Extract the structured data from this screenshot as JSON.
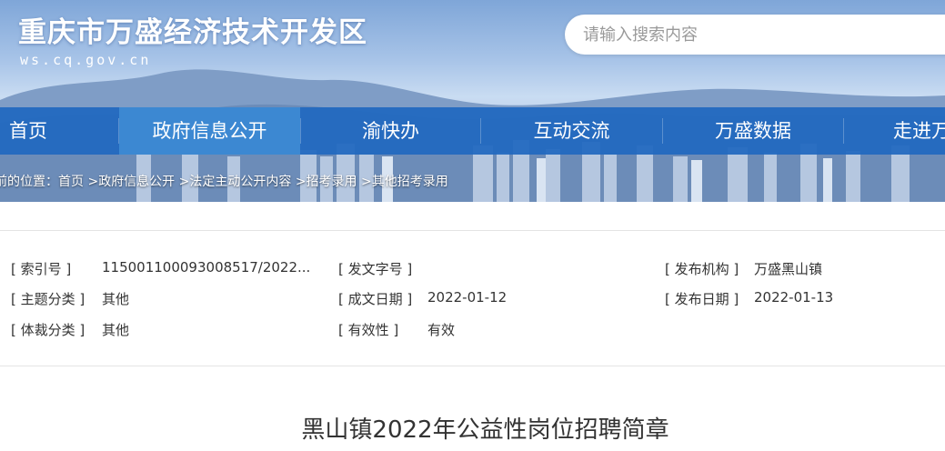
{
  "header": {
    "site_title": "重庆市万盛经济技术开发区",
    "site_domain": "ws.cq.gov.cn",
    "search_placeholder": "请输入搜索内容"
  },
  "nav": {
    "items": [
      "首页",
      "政府信息公开",
      "渝快办",
      "互动交流",
      "万盛数据",
      "走进万"
    ],
    "active_index": 1
  },
  "breadcrumb": {
    "prefix": "前的位置：",
    "items": [
      "首页",
      "政府信息公开",
      "法定主动公开内容",
      "招考录用",
      "其他招考录用"
    ],
    "separator": " >"
  },
  "meta": {
    "index_no_label": "[ 索引号 ]",
    "index_no_value": "115001100093008517/2022...",
    "doc_no_label": "[ 发文字号 ]",
    "doc_no_value": "",
    "publisher_label": "[ 发布机构 ]",
    "publisher_value": "万盛黑山镇",
    "topic_label": "[ 主题分类 ]",
    "topic_value": "其他",
    "created_label": "[ 成文日期 ]",
    "created_value": "2022-01-12",
    "publish_date_label": "[ 发布日期 ]",
    "publish_date_value": "2022-01-13",
    "genre_label": "[ 体裁分类 ]",
    "genre_value": "其他",
    "validity_label": "[ 有效性 ]",
    "validity_value": "有效"
  },
  "article": {
    "title": "黑山镇2022年公益性岗位招聘简章"
  },
  "colors": {
    "nav_bg": "#2068c0",
    "nav_active": "#3c88d2",
    "text": "#333333"
  }
}
